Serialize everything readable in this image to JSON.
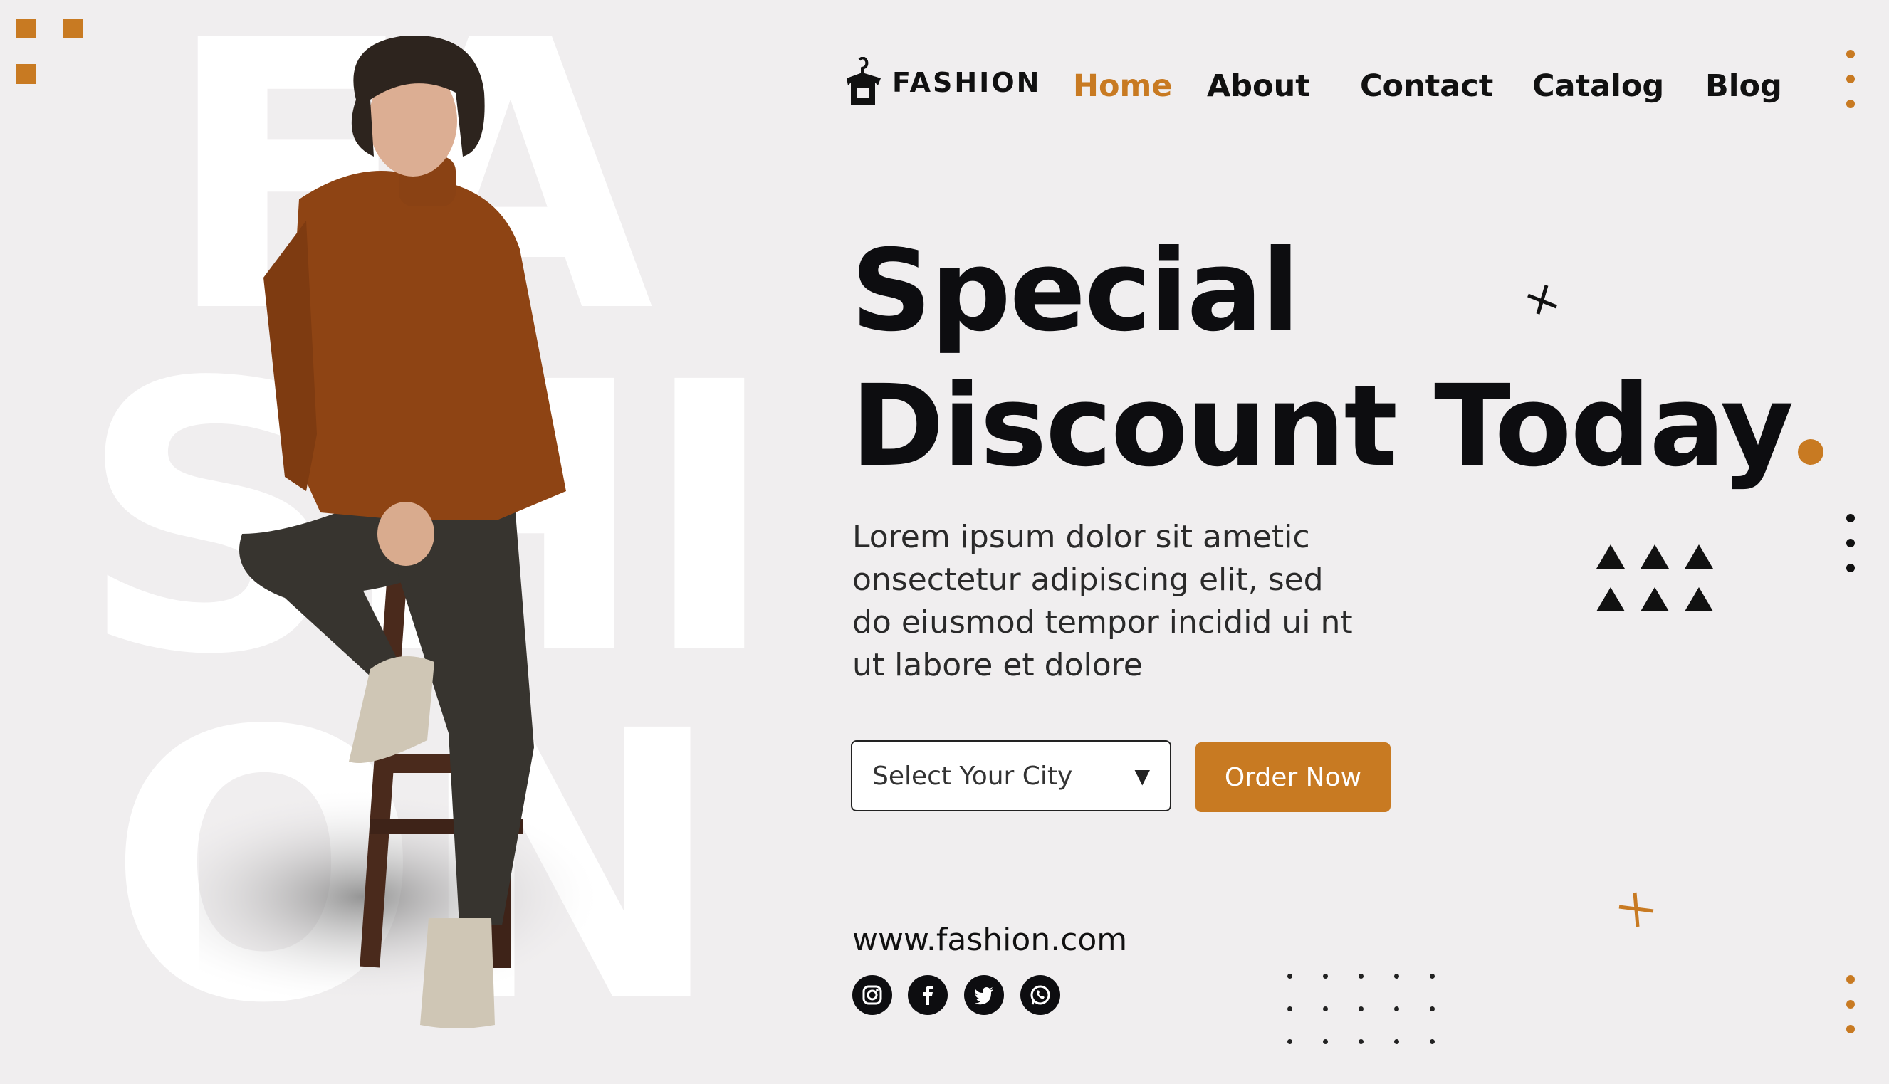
{
  "background_watermark": {
    "row1": "FA",
    "row2": "SHI",
    "row3": "ON"
  },
  "nav": {
    "logo_text": "FASHION",
    "links": [
      "Home",
      "About",
      "Contact",
      "Catalog",
      "Blog"
    ],
    "active_index": 0
  },
  "hero": {
    "headline_line1": "Special",
    "headline_line2": "Discount Today",
    "body": "Lorem ipsum dolor sit ametic onsectetur adipiscing elit, sed do eiusmod tempor incidid ui nt ut labore et dolore"
  },
  "form": {
    "select_placeholder": "Select Your City",
    "order_button": "Order Now"
  },
  "footer": {
    "website": "www.fashion.com",
    "social_icons": [
      "instagram-icon",
      "facebook-icon",
      "twitter-icon",
      "whatsapp-icon"
    ]
  },
  "colors": {
    "accent": "#c87a22",
    "background": "#f0eeef",
    "text": "#0d0d10"
  }
}
